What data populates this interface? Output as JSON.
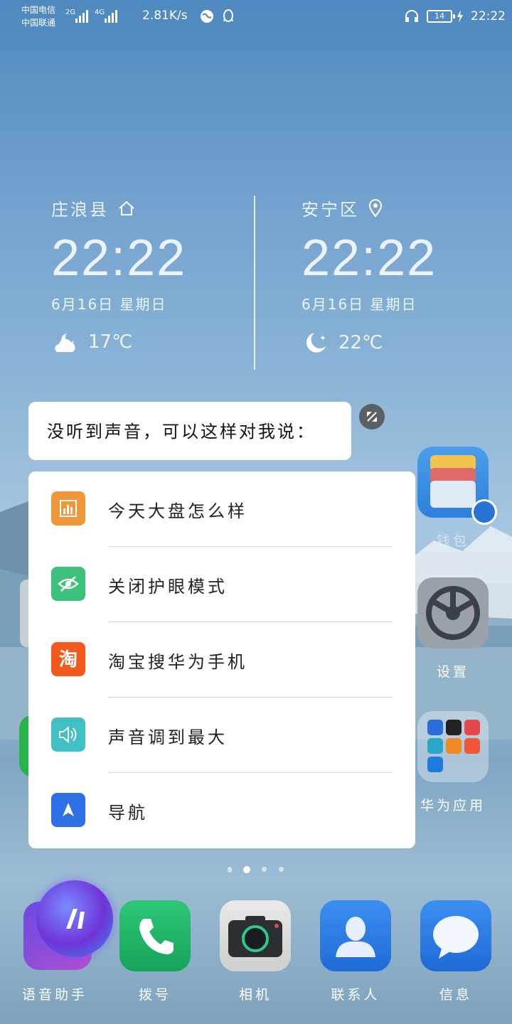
{
  "statusbar": {
    "carrier1": "中国电信",
    "carrier2": "中国联通",
    "net1": "2G",
    "net2": "4G",
    "speed": "2.81K/s",
    "battery": "14",
    "time": "22:22"
  },
  "clocks": [
    {
      "city": "庄浪县",
      "time": "22:22",
      "date": "6月16日 星期日",
      "temp": "17℃",
      "city_icon": "home-icon",
      "weather_icon": "cloud-moon-icon"
    },
    {
      "city": "安宁区",
      "time": "22:22",
      "date": "6月16日 星期日",
      "temp": "22℃",
      "city_icon": "location-pin-icon",
      "weather_icon": "moon-icon"
    }
  ],
  "assistant": {
    "prompt": "没听到声音，可以这样对我说：",
    "suggestions": [
      {
        "label": "今天大盘怎么样",
        "icon": "stock-chart-icon",
        "color": "#f0973a"
      },
      {
        "label": "关闭护眼模式",
        "icon": "eye-off-icon",
        "color": "#3ec27b"
      },
      {
        "label": "淘宝搜华为手机",
        "icon": "taobao-icon",
        "color": "#f25a1d"
      },
      {
        "label": "声音调到最大",
        "icon": "volume-icon",
        "color": "#3fc0c4"
      },
      {
        "label": "导航",
        "icon": "navigation-arrow-icon",
        "color": "#2f6fe6"
      }
    ]
  },
  "right_apps": [
    {
      "name": "钱包"
    },
    {
      "name": "设置"
    },
    {
      "name": "华为应用"
    }
  ],
  "dock": [
    {
      "name": "语音助手"
    },
    {
      "name": "拨号"
    },
    {
      "name": "相机"
    },
    {
      "name": "联系人"
    },
    {
      "name": "信息"
    }
  ]
}
